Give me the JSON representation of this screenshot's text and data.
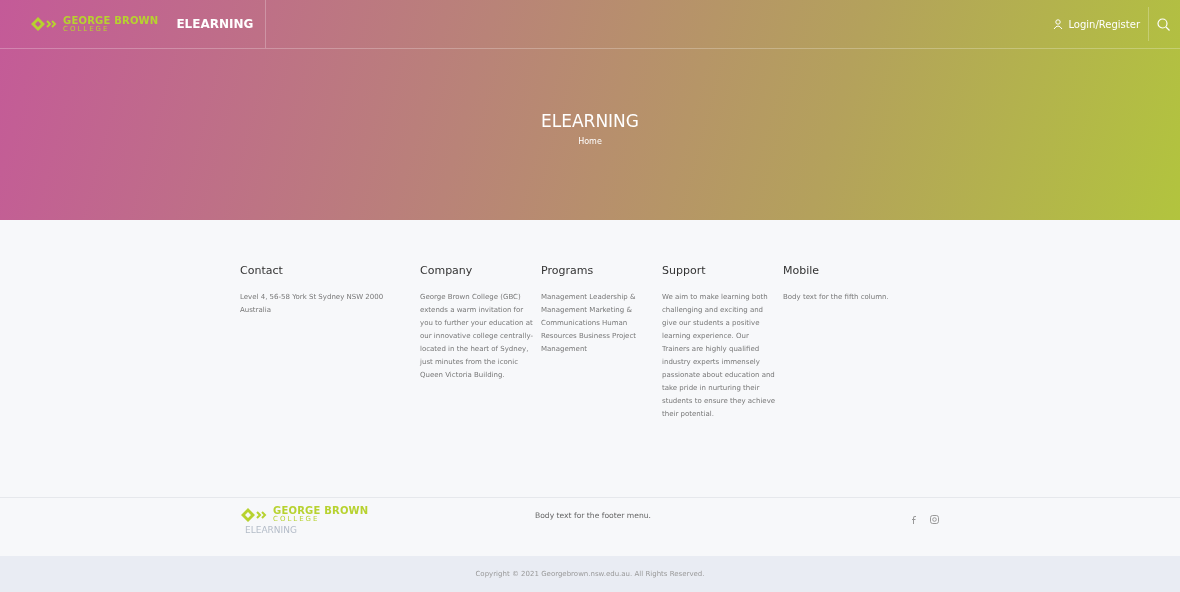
{
  "header": {
    "logo": {
      "name": "GEORGE BROWN",
      "sub": "COLLEGE"
    },
    "site_title": "ELEARNING",
    "login": "Login/Register"
  },
  "hero": {
    "title": "ELEARNING",
    "breadcrumb": "Home"
  },
  "footer_columns": [
    {
      "heading": "Contact",
      "body": "Level 4, 56-58 York St Sydney NSW 2000 Australia"
    },
    {
      "heading": "Company",
      "body": "George Brown College (GBC) extends a warm invitation for you to further your education at our innovative college centrally-located in the heart of Sydney, just minutes from the iconic Queen Victoria Building."
    },
    {
      "heading": "Programs",
      "body": "Management Leadership & Management Marketing & Communications Human Resources Business Project Management"
    },
    {
      "heading": "Support",
      "body": "We aim to make learning both challenging and exciting and give our students a positive learning experience. Our Trainers are highly qualified industry experts immensely passionate about education and take pride in nurturing their students to ensure they achieve their potential."
    },
    {
      "heading": "Mobile",
      "body": "Body text for the fifth column."
    }
  ],
  "footer_bar": {
    "logo": {
      "name": "GEORGE BROWN",
      "sub": "COLLEGE"
    },
    "site_title": "ELEARNING",
    "menu_text": "Body text for the footer menu."
  },
  "copyright": "Copyright © 2021 Georgebrown.nsw.edu.au. All Rights Reserved."
}
